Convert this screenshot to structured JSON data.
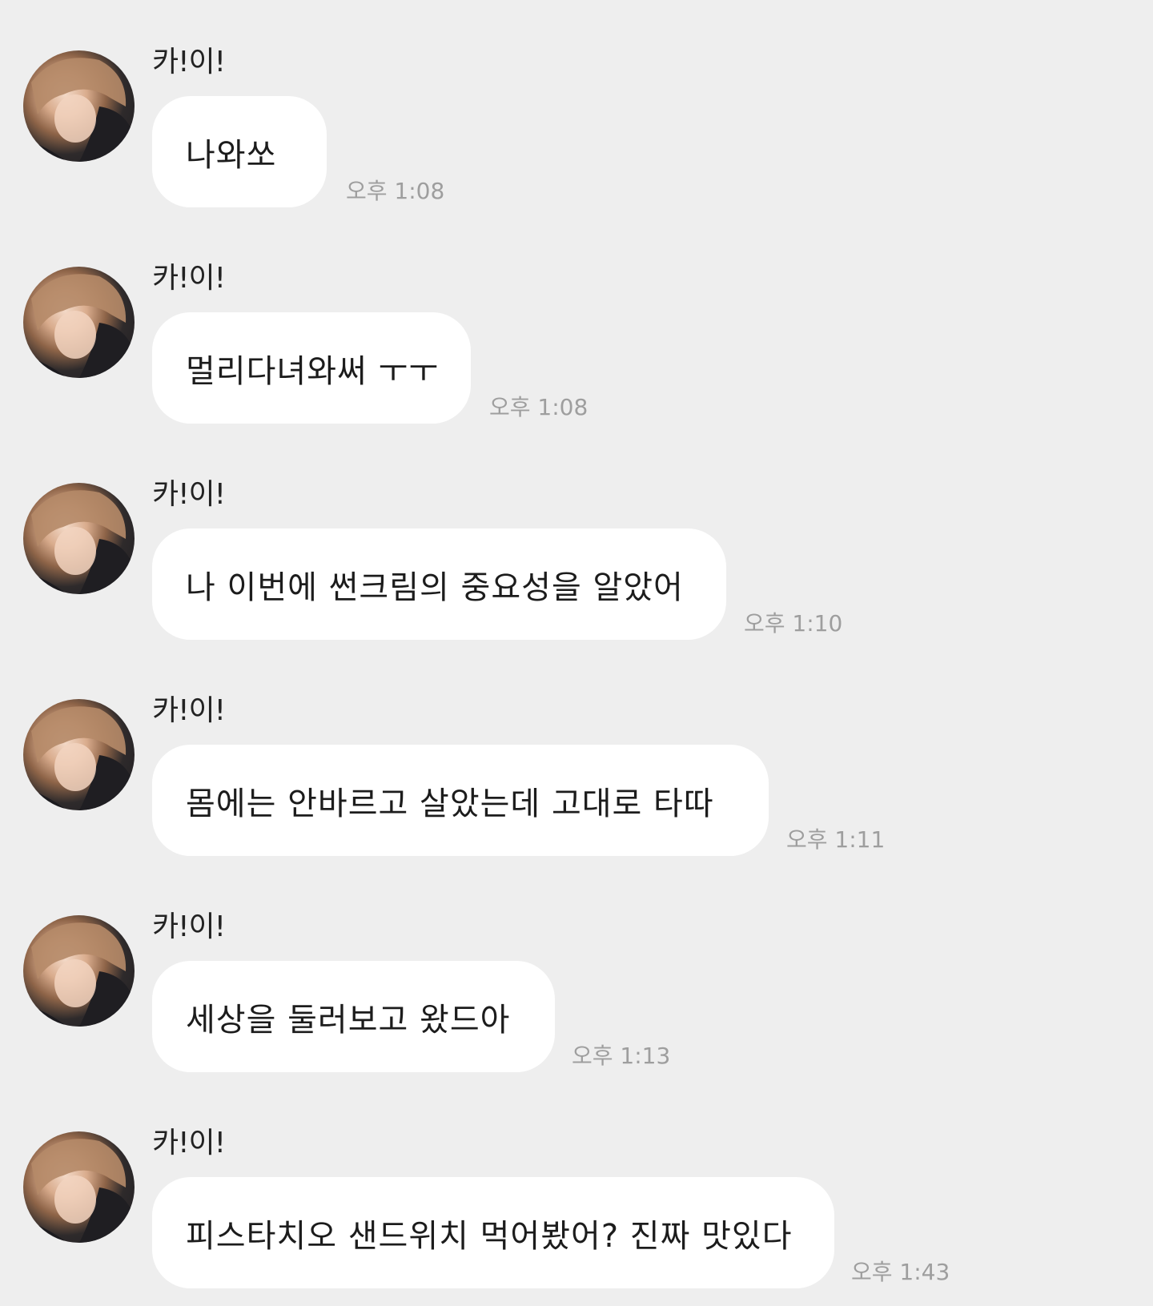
{
  "sender_name": "카!이!",
  "messages": [
    {
      "text": "나와쏘",
      "time": "오후 1:08"
    },
    {
      "text": "멀리다녀와써 ㅜㅜ",
      "time": "오후 1:08"
    },
    {
      "text": "나 이번에 썬크림의 중요성을 알았어",
      "time": "오후 1:10"
    },
    {
      "text": "몸에는 안바르고 살았는데 고대로 타따",
      "time": "오후 1:11"
    },
    {
      "text": "세상을 둘러보고 왔드아",
      "time": "오후 1:13"
    },
    {
      "text": "피스타치오 샌드위치 먹어봤어? 진짜 맛있다",
      "time": "오후 1:43"
    }
  ],
  "colors": {
    "background": "#eeeeee",
    "bubble": "#ffffff",
    "text": "#1c1c1c",
    "timestamp": "#9e9e9e"
  },
  "icons": {
    "avatar": "profile-photo"
  }
}
